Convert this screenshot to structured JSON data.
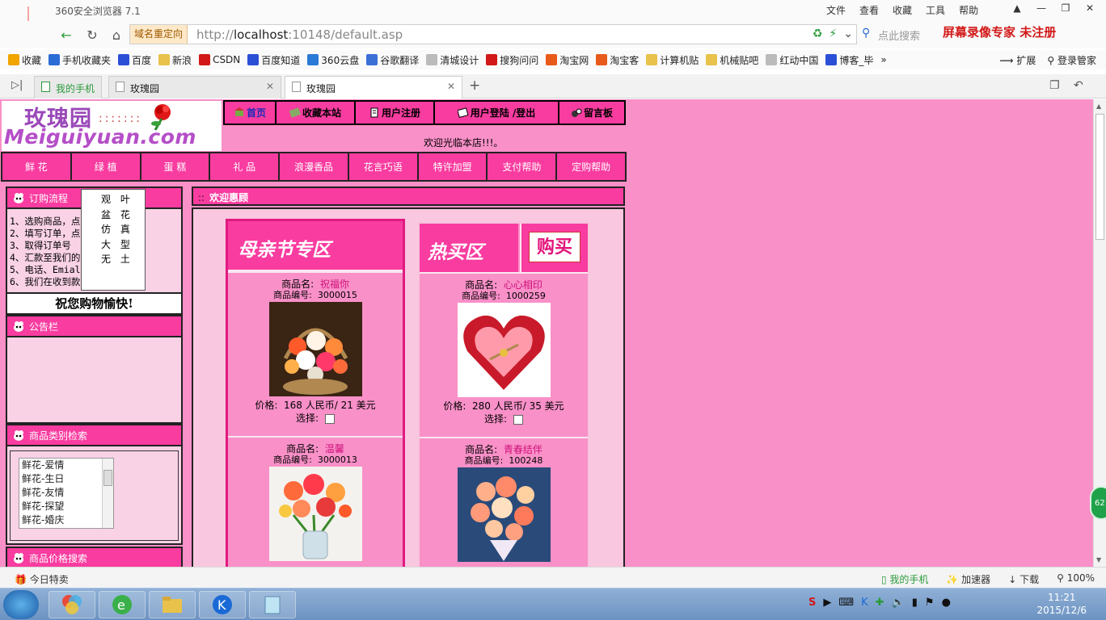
{
  "browser": {
    "title": "360安全浏览器 7.1",
    "menus": [
      "文件",
      "查看",
      "收藏",
      "工具",
      "帮助"
    ],
    "redirect_label": "域名重定向",
    "url_prefix": "http://",
    "url_host": "localhost",
    "url_rest": ":10148/default.asp",
    "search_placeholder": "点此搜索",
    "recorder_text": "屏幕录像专家  未注册",
    "bookmarks": [
      {
        "label": "收藏",
        "icon": "star-icon",
        "color": "#f0a500"
      },
      {
        "label": "手机收藏夹",
        "icon": "phone-icon",
        "color": "#2a6bd6"
      },
      {
        "label": "百度",
        "icon": "baidu-paw-icon",
        "color": "#2a4fd6"
      },
      {
        "label": "新浪",
        "icon": "folder-icon",
        "color": "#e8c24a"
      },
      {
        "label": "CSDN",
        "icon": "csdn-icon",
        "color": "#d21818"
      },
      {
        "label": "百度知道",
        "icon": "baidu-paw-icon",
        "color": "#2a4fd6"
      },
      {
        "label": "360云盘",
        "icon": "cloud-icon",
        "color": "#2a7ad6"
      },
      {
        "label": "谷歌翻译",
        "icon": "translate-icon",
        "color": "#3b6fd6"
      },
      {
        "label": "清城设计",
        "icon": "page-icon",
        "color": "#bbbbbb"
      },
      {
        "label": "搜狗问问",
        "icon": "sogou-icon",
        "color": "#d21818"
      },
      {
        "label": "淘宝网",
        "icon": "taobao-icon",
        "color": "#e85a1a"
      },
      {
        "label": "淘宝客",
        "icon": "taobao-icon",
        "color": "#e85a1a"
      },
      {
        "label": "计算机贴",
        "icon": "folder-icon",
        "color": "#e8c24a"
      },
      {
        "label": "机械贴吧",
        "icon": "folder-icon",
        "color": "#e8c24a"
      },
      {
        "label": "红动中国",
        "icon": "page-icon",
        "color": "#bbbbbb"
      },
      {
        "label": "博客_毕",
        "icon": "baidu-paw-icon",
        "color": "#2a4fd6"
      }
    ],
    "bm_right": [
      "扩展",
      "登录管家"
    ],
    "tabs": [
      {
        "label": "我的手机",
        "active": false
      },
      {
        "label": "玫瑰园",
        "active": false
      },
      {
        "label": "玫瑰园",
        "active": true
      }
    ],
    "status_left": "今日特卖",
    "status_right": [
      "我的手机",
      "加速器",
      "下载",
      "100%"
    ]
  },
  "site": {
    "logo_cn": "玫瑰园",
    "logo_dots": ":::::::",
    "logo_en": "Meiguiyuan.com",
    "top_nav": [
      "首页",
      "收藏本站",
      "用户注册",
      "用户登陆 /登出",
      "留言板"
    ],
    "welcome": "欢迎光临本店!!!。",
    "categories": [
      "鲜 花",
      "绿 植",
      "蛋 糕",
      "礼 品",
      "浪漫香品",
      "花言巧语",
      "特许加盟",
      "支付帮助",
      "定购帮助"
    ],
    "dropdown": [
      "观 叶",
      "盆 花",
      "仿 真",
      "大 型",
      "无 土"
    ],
    "order_title": "订购流程",
    "order_steps": [
      "1、选购商品，点",
      "2、填写订单，点",
      "3、取得订单号",
      "4、汇款至我们的",
      "5、电话、Emial",
      "6、我们在收到款         货"
    ],
    "happy": "祝您购物愉快!",
    "notice_title": "公告栏",
    "cat_search_title": "商品类别检索",
    "cat_list": [
      "鲜花-爱情",
      "鲜花-生日",
      "鲜花-友情",
      "鲜花-探望",
      "鲜花-婚庆"
    ],
    "price_search_title": "商品价格搜索",
    "main_title": "欢迎惠顾",
    "zone_mother": "母亲节专区",
    "zone_hot": "热买区",
    "buy_badge": "购买",
    "labels": {
      "name": "商品名:",
      "code": "商品编号:",
      "price": "价格:",
      "select": "选择:"
    },
    "products_mother": [
      {
        "name": "祝福你",
        "code": "3000015",
        "price": "168 人民币/ 21 美元"
      },
      {
        "name": "温馨",
        "code": "3000013",
        "price": ""
      }
    ],
    "products_hot": [
      {
        "name": "心心相印",
        "code": "1000259",
        "price": "280 人民币/ 35 美元"
      },
      {
        "name": "青春结伴",
        "code": "100248",
        "price": ""
      }
    ]
  },
  "taskbar": {
    "time": "11:21",
    "date": "2015/12/6",
    "badge": "62"
  }
}
